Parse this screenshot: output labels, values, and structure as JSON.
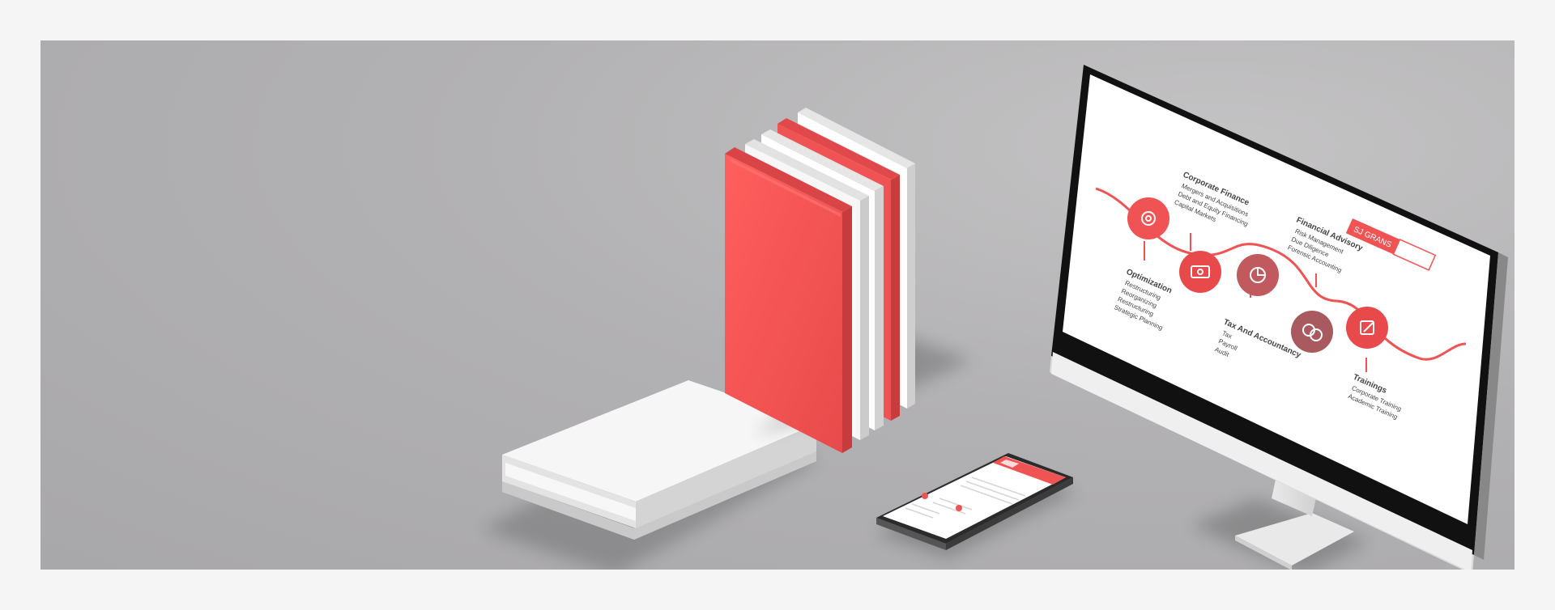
{
  "colors": {
    "page_bg": "#f5f5f5",
    "scene_bg": "#b3b2b4",
    "accent_red": "#f05353",
    "dark_red": "#a85a5f",
    "paper_white": "#ffffff"
  },
  "monitor_slide": {
    "stages": [
      {
        "title": "Corporate Finance",
        "bullets": [
          "Mergers and Acquisitions",
          "Debt and Equity Financing",
          "Capital Markets"
        ]
      },
      {
        "title": "Financial Advisory",
        "bullets": [
          "Risk Management",
          "Due Diligence",
          "Forensic Accounting"
        ]
      },
      {
        "title": "Optimization",
        "bullets": [
          "Restructuring",
          "Reorganizing",
          "Restructuring",
          "Strategic Planning"
        ]
      },
      {
        "title": "Tax And Accountancy",
        "bullets": [
          "Tax",
          "Payroll",
          "Audit"
        ]
      },
      {
        "title": "Trainings",
        "bullets": [
          "Corporate Training",
          "Academic Training"
        ]
      }
    ],
    "logo": "SJ GRANS",
    "icons": [
      "gear-icon",
      "money-icon",
      "pie-chart-icon",
      "chat-icon",
      "edit-icon"
    ]
  },
  "phone_screen": {
    "icons": [
      "document-icon"
    ]
  }
}
